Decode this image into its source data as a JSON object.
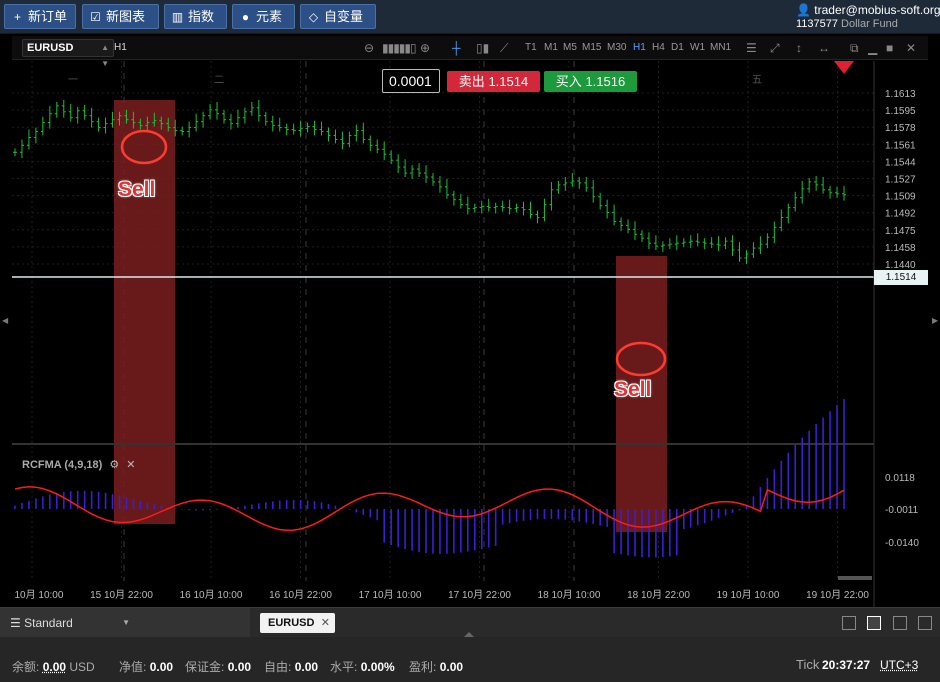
{
  "toolbar": {
    "buttons": [
      {
        "label": "新订单",
        "icon": "plus-icon"
      },
      {
        "label": "新图表",
        "icon": "chart-icon"
      },
      {
        "label": "指数",
        "icon": "bar-chart-icon"
      },
      {
        "label": "元素",
        "icon": "elements-icon"
      },
      {
        "label": "自变量",
        "icon": "diamond-icon"
      }
    ]
  },
  "account": {
    "user": "trader@mobius-soft.org",
    "id": "1137577",
    "fund": "Dollar Fund"
  },
  "chart_header": {
    "symbol": "EURUSD",
    "timeframe": "H1",
    "timeframes": [
      "T1",
      "M1",
      "M5",
      "M15",
      "M30",
      "H1",
      "H4",
      "D1",
      "W1",
      "MN1"
    ],
    "active_timeframe": "H1"
  },
  "quote": {
    "step": "0.0001",
    "sell_label": "卖出",
    "sell_price": "1.1514",
    "buy_label": "买入",
    "buy_price": "1.1516"
  },
  "price_axis": {
    "labels": [
      "1.1613",
      "1.1595",
      "1.1578",
      "1.1561",
      "1.1544",
      "1.1527",
      "1.1509",
      "1.1492",
      "1.1475",
      "1.1458",
      "1.1440"
    ],
    "current": "1.1514"
  },
  "time_axis": {
    "labels": [
      "15 10月 10:00",
      "15 10月 22:00",
      "16 10月 10:00",
      "16 10月 22:00",
      "17 10月 10:00",
      "17 10月 22:00",
      "18 10月 10:00",
      "18 10月 22:00",
      "19 10月 10:00",
      "19 10月 22:00"
    ]
  },
  "day_markers": [
    "一",
    "二",
    "五"
  ],
  "annotations": {
    "sell_1": "Sell",
    "sell_2": "Sell"
  },
  "indicator": {
    "name": "RCFMA (4,9,18)",
    "levels": [
      "0.0118",
      "-0.0011",
      "-0.0140"
    ]
  },
  "colors": {
    "candle": "#19c13a",
    "sell": "#d3283a",
    "buy": "#1d9a3c",
    "histogram": "#3a1fd6",
    "signal_line": "#ff1a1a",
    "highlight": "#7a1e1e"
  },
  "tabs": {
    "template": "Standard",
    "active_tab": "EURUSD"
  },
  "status": {
    "balance_label": "余额:",
    "balance_value": "0.00",
    "balance_currency": "USD",
    "equity_label": "净值:",
    "equity_value": "0.00",
    "margin_label": "保证金:",
    "margin_value": "0.00",
    "free_label": "自由:",
    "free_value": "0.00",
    "level_label": "水平:",
    "level_value": "0.00%",
    "profit_label": "盈利:",
    "profit_value": "0.00",
    "tick_label": "Tick",
    "time": "20:37:27",
    "timezone": "UTC+3"
  }
}
